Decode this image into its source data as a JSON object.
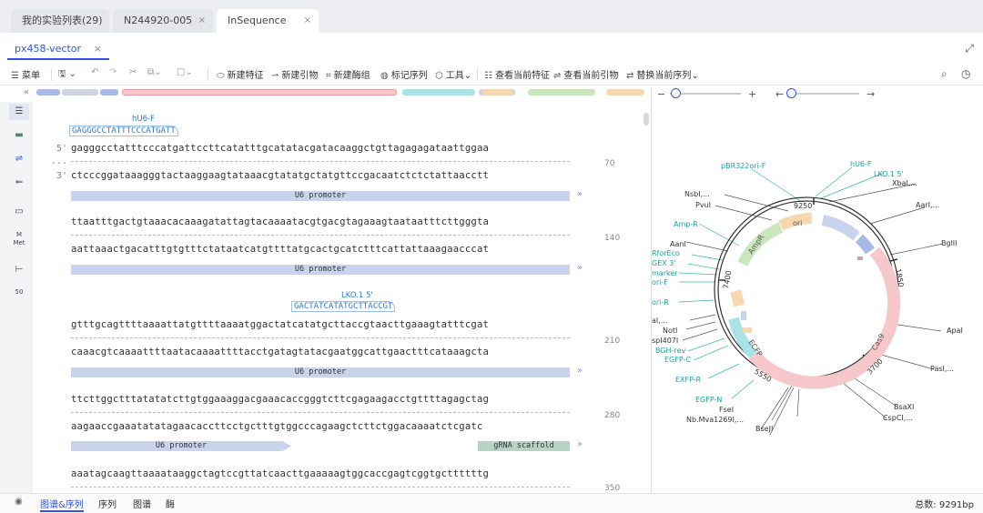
{
  "tabs": [
    {
      "label": "我的实验列表(29)"
    },
    {
      "label": "N244920-005"
    },
    {
      "label": "InSequence"
    }
  ],
  "close_symbol": "×",
  "subtab": {
    "label": "px458-vector"
  },
  "toolbar": {
    "menu": "菜单",
    "new_feature": "新建特征",
    "new_primer": "新建引物",
    "new_enzyme_set": "新建酶组",
    "mark_sequence": "标记序列",
    "tools": "工具",
    "view_feature": "查看当前特征",
    "view_primer": "查看当前引物",
    "replace_sequence": "替换当前序列"
  },
  "sequence_rows": [
    {
      "top": "gagggcctatttcccatgattccttcatatttgcatatacgatacaaggctgttagagagataattggaa",
      "bottom": "ctcccggataaagggtactaaggaagtataaacgtatatgctatgttccgacaatctctctattaacctt",
      "pos": "70",
      "prime5": "5'",
      "prime3": "3'",
      "dots": "...",
      "features": [
        {
          "label": "U6 promoter"
        }
      ]
    },
    {
      "top": "ttaatttgactgtaaacacaaagatattagtacaaaatacgtgacgtagaaagtaataatttcttgggta",
      "bottom": "aattaaactgacatttgtgtttctataatcatgttttatgcactgcatctttcattattaaagaacccat",
      "pos": "140",
      "features": [
        {
          "label": "U6 promoter"
        }
      ]
    },
    {
      "top": "gtttgcagttttaaaattatgttttaaaatggactatcatatgcttaccgtaacttgaaagtatttcgat",
      "bottom": "caaacgtcaaaattttaatacaaaattttacctgatagtatacgaatggcattgaactttcataaagcta",
      "pos": "210",
      "features": [
        {
          "label": "U6 promoter"
        }
      ]
    },
    {
      "top": "ttcttggctttatatatcttgtggaaaggacgaaacaccgggtcttcgagaagacctgttttagagctag",
      "bottom": "aagaaccgaaatatatagaacaccttcctgctttgtggcccagaagctcttctggacaaaatctcgatc",
      "pos": "280",
      "features": [
        {
          "label": "U6 promoter"
        },
        {
          "label": "gRNA scaffold"
        }
      ]
    },
    {
      "top": "aaatagcaagttaaaataaggctagtccgttatcaacttgaaaaagtggcaccgagtcggtgcttttttg",
      "pos": "350"
    }
  ],
  "primers": [
    {
      "name": "hU6-F",
      "seq": "GAGGGCCTATTTCCCATGATT"
    },
    {
      "name": "LKO.1 5'",
      "seq": "GACTATCATATGCTTACCGT"
    }
  ],
  "left_panel": {
    "met_label": "Met",
    "met_letter": "M",
    "scale_label": "50"
  },
  "map": {
    "ticks": [
      "9250",
      "1850",
      "3700",
      "5550",
      "7400"
    ],
    "features": [
      "ori",
      "AmpR",
      "Cas9",
      "ECFP"
    ],
    "labels_left": [
      "pBR322ori-F",
      "NsbI,...",
      "PvuI",
      "Amp-R",
      "AanI",
      "RforEco",
      "GEX 3'",
      "marker",
      "ori-F",
      "ori-R",
      "aI,...",
      "NotI",
      "spI407I",
      "BGH-rev",
      "EGFP-C",
      "EXFP-R",
      "EGFP-N",
      "FseI",
      "Nb.Mva1269I,...",
      "BseJI"
    ],
    "labels_right": [
      "hU6-F",
      "LKO.1 5'",
      "XbaI,...",
      "AarI,...",
      "BglII",
      "ApaI",
      "PasI,...",
      "BsaXI",
      "CspCI,..."
    ]
  },
  "bottom": {
    "tabs": [
      "图谱&序列",
      "序列",
      "图谱",
      "酶"
    ],
    "total": "总数: 9291bp"
  },
  "colors": {
    "accent": "#2f54eb",
    "feature": "#c9d4ec",
    "cas9": "#f6c8cc"
  }
}
